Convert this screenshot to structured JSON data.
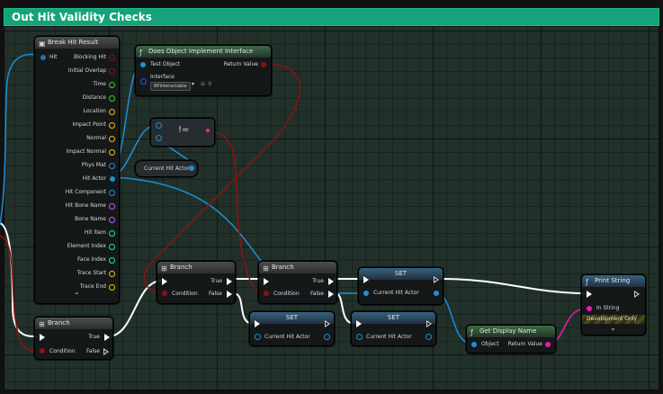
{
  "comment": {
    "title": "Out Hit Validity Checks",
    "color": "#16a37a"
  },
  "colors": {
    "exec": "#ffffff",
    "object": "#1e8fd6",
    "bool": "#8b1212",
    "string": "#e61ea6",
    "struct": "#2c6fb6",
    "vector": "#f2c010",
    "float": "#3fcf2d",
    "name": "#c35cff",
    "int": "#1ee6a6",
    "physmat": "#2d8fd2"
  },
  "break_hit": {
    "title": "Break Hit Result",
    "icon": "break-struct-icon",
    "input": "Hit",
    "outputs": [
      "Blocking Hit",
      "Initial Overlap",
      "Time",
      "Distance",
      "Location",
      "Impact Point",
      "Normal",
      "Impact Normal",
      "Phys Mat",
      "Hit Actor",
      "Hit Component",
      "Hit Bone Name",
      "Bone Name",
      "Hit Item",
      "Element Index",
      "Face Index",
      "Trace Start",
      "Trace End"
    ],
    "expand": "⌃"
  },
  "implements": {
    "title": "Does Object Implement Interface",
    "icon": "function-icon",
    "in_object": "Test Object",
    "out": "Return Value",
    "interface_label": "Interface",
    "interface_value": "BPInteractable"
  },
  "not_equal": {
    "symbol": "!="
  },
  "get_var": {
    "label": "Current Hit Actor"
  },
  "branch_bottom": {
    "title": "Branch",
    "condition": "Condition",
    "true": "True",
    "false": "False"
  },
  "branch_mid": {
    "title": "Branch",
    "condition": "Condition",
    "true": "True",
    "false": "False"
  },
  "branch_right": {
    "title": "Branch",
    "condition": "Condition",
    "true": "True",
    "false": "False"
  },
  "set_top": {
    "title": "SET",
    "pin": "Current Hit Actor"
  },
  "set_bottom_a": {
    "title": "SET",
    "pin": "Current Hit Actor"
  },
  "set_bottom_b": {
    "title": "SET",
    "pin": "Current Hit Actor"
  },
  "get_display": {
    "title": "Get Display Name",
    "icon": "function-icon",
    "in": "Object",
    "out": "Return Value"
  },
  "print_string": {
    "title": "Print String",
    "icon": "function-icon",
    "in_string": "In String",
    "dev_only": "Development Only",
    "expand": "⌄"
  }
}
